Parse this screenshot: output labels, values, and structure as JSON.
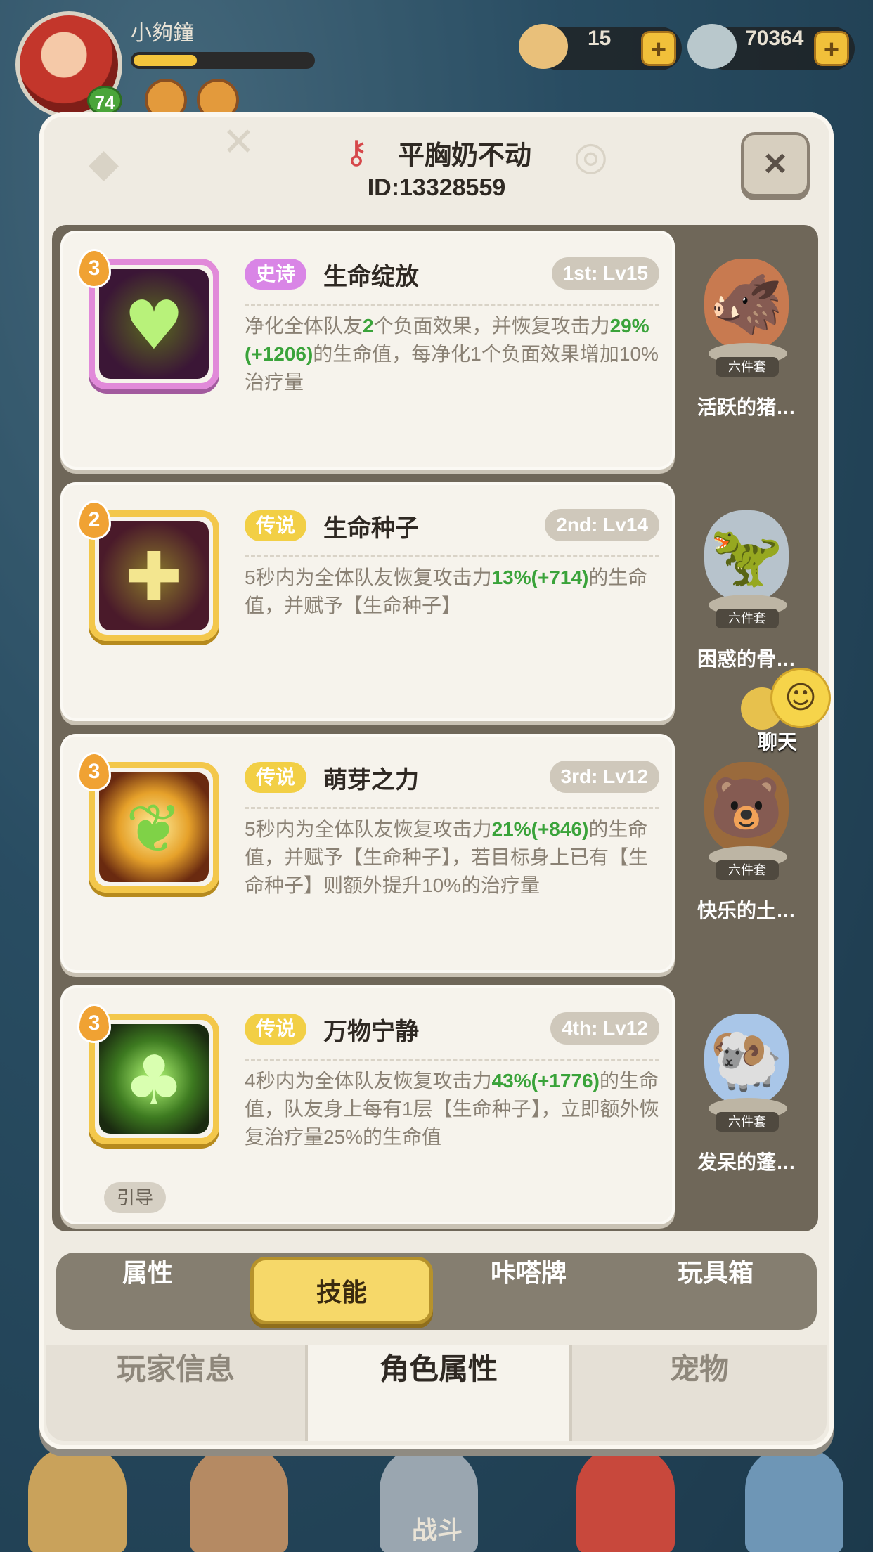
{
  "hud": {
    "player_name": "小夠鐘",
    "level": "74",
    "currency_1": "15",
    "currency_2": "70364",
    "plus": "+"
  },
  "dialog": {
    "title": "平胸奶不动",
    "id": "ID:13328559",
    "close": "×"
  },
  "skills": [
    {
      "level_badge": "3",
      "rarity": "史诗",
      "name": "生命绽放",
      "rank": "1st: Lv15",
      "desc": [
        "净化全体队友",
        "2",
        "个负面效果，并恢复攻击力",
        "29%(+1206)",
        "的生命值，每净化1个负面效果增加10%治疗量"
      ],
      "suit_tag": "六件套",
      "suit_name": "活跃的猪…"
    },
    {
      "level_badge": "2",
      "rarity": "传说",
      "name": "生命种子",
      "rank": "2nd: Lv14",
      "desc": [
        "5秒内为全体队友恢复攻击力",
        "13%(+714)",
        "的生命值，并赋予【生命种子】"
      ],
      "suit_tag": "六件套",
      "suit_name": "困惑的骨…"
    },
    {
      "level_badge": "3",
      "rarity": "传说",
      "name": "萌芽之力",
      "rank": "3rd: Lv12",
      "desc": [
        "5秒内为全体队友恢复攻击力",
        "21%(+846)",
        "的生命值，并赋予【生命种子】，若目标身上已有【生命种子】则额外提升10%的治疗量"
      ],
      "suit_tag": "六件套",
      "suit_name": "快乐的土…"
    },
    {
      "level_badge": "3",
      "rarity": "传说",
      "name": "万物宁静",
      "rank": "4th: Lv12",
      "desc": [
        "4秒内为全体队友恢复攻击力",
        "43%(+1776)",
        "的生命值，队友身上每有1层【生命种子】，立即额外恢复治疗量25%的生命值"
      ],
      "suit_tag": "六件套",
      "suit_name": "发呆的蓬…",
      "guide": "引导"
    }
  ],
  "chat_label": "聊天",
  "tabs": [
    "属性",
    "技能",
    "咔嗒牌",
    "玩具箱"
  ],
  "bottom_tabs": [
    "玩家信息",
    "角色属性",
    "宠物"
  ],
  "battle_label": "战斗",
  "colors": {
    "legend_rarity": "#f2cf45",
    "epic_rarity": "#d985e6",
    "highlight_green": "#3aa33a",
    "active_tab": "#f6d869"
  }
}
